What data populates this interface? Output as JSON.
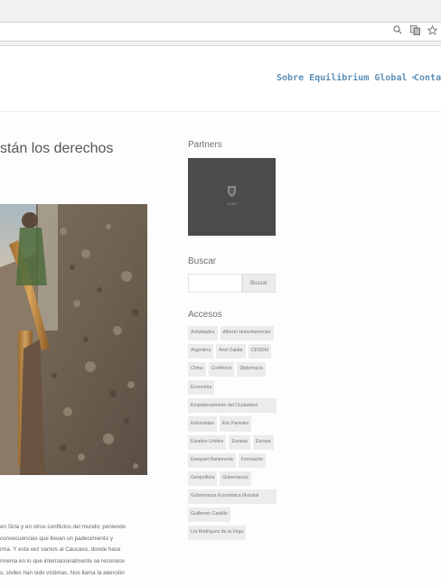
{
  "browser": {
    "icons": [
      "search-icon",
      "translate-icon",
      "star-icon"
    ]
  },
  "nav": {
    "items": [
      {
        "label": "Sobre Equilibrium Global",
        "has_dropdown": true
      },
      {
        "label": "Conta"
      }
    ]
  },
  "article": {
    "title": "stán los derechos",
    "excerpt_lines": [
      "en Siria y en otros conflictos del mundo; poniendo",
      "consecuencias que llevan un padecimiento y",
      "rma. Y esta vez vamos al Cáucaso, donde hace",
      "rmenia en lo que internacionalmente se reconoce",
      "s, civiles han sido víctimas. Nos llama la atención"
    ]
  },
  "sidebar": {
    "partners": {
      "heading": "Partners",
      "logo_text": "CEIRI"
    },
    "search": {
      "heading": "Buscar",
      "input_value": "",
      "button_label": "Buscar"
    },
    "accesos": {
      "heading": "Accesos",
      "tags": [
        {
          "label": "Actividades"
        },
        {
          "label": "Alberto Hutschenreuter"
        },
        {
          "label": "Argentina"
        },
        {
          "label": "Ariel Zaidar"
        },
        {
          "label": "CESDAI"
        },
        {
          "label": "China"
        },
        {
          "label": "Conflictos"
        },
        {
          "label": "Diplomacia"
        },
        {
          "label": "Economía"
        },
        {
          "label": "Empoderamiento del Ciudadano",
          "wide": true
        },
        {
          "label": "Entrevistas"
        },
        {
          "label": "Eric Paredes"
        },
        {
          "label": "Estados Unidos"
        },
        {
          "label": "Eurasia"
        },
        {
          "label": "Europa"
        },
        {
          "label": "Ezequiel Ramoneda"
        },
        {
          "label": "Formación"
        },
        {
          "label": "Geopolítica"
        },
        {
          "label": "Gobernanza"
        },
        {
          "label": "Gobernanza Económica Mundial",
          "wide": true
        },
        {
          "label": "Guillermo Castillo"
        },
        {
          "label": "Lía Rodriguez de la Vega"
        }
      ]
    }
  }
}
